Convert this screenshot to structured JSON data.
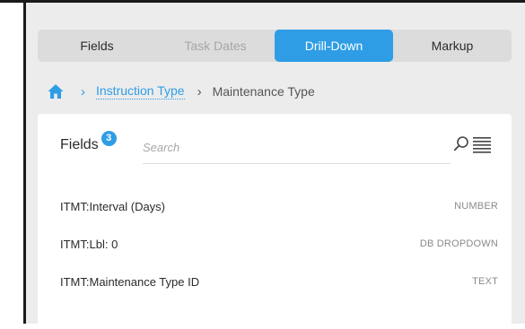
{
  "tabs": [
    {
      "label": "Fields",
      "state": "normal"
    },
    {
      "label": "Task Dates",
      "state": "disabled"
    },
    {
      "label": "Drill-Down",
      "state": "active"
    },
    {
      "label": "Markup",
      "state": "normal"
    }
  ],
  "breadcrumb": {
    "home_icon": "home-icon",
    "items": [
      {
        "label": "Instruction Type",
        "link": true
      },
      {
        "label": "Maintenance Type",
        "link": false
      }
    ]
  },
  "fields_panel": {
    "title": "Fields",
    "count": "3",
    "search_placeholder": "Search",
    "search_value": "",
    "icons": [
      "search-icon",
      "list-icon"
    ],
    "rows": [
      {
        "name": "ITMT:Interval (Days)",
        "type": "NUMBER"
      },
      {
        "name": "ITMT:Lbl: 0",
        "type": "DB DROPDOWN"
      },
      {
        "name": "ITMT:Maintenance Type ID",
        "type": "TEXT"
      }
    ]
  },
  "colors": {
    "accent": "#2f9de6",
    "panel_bg": "#ececec",
    "tab_bg": "#dcdcdc"
  }
}
